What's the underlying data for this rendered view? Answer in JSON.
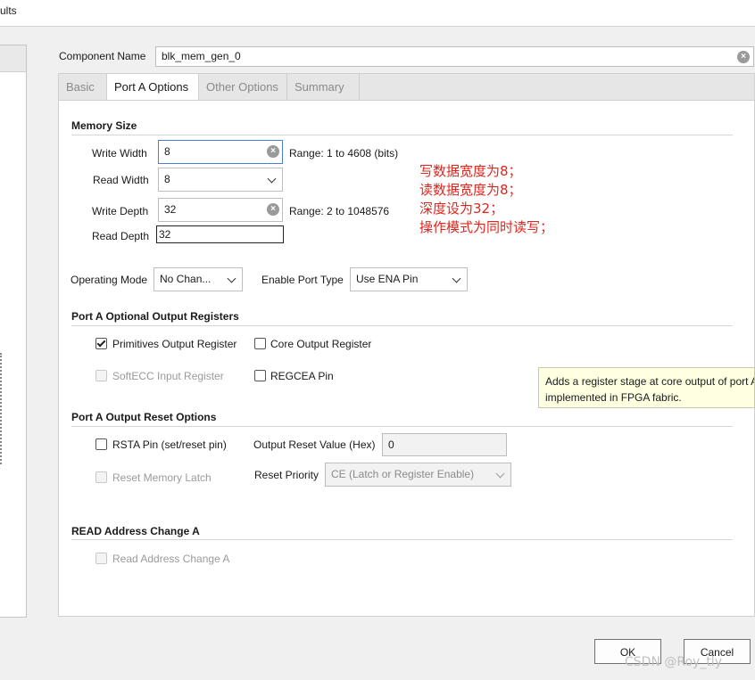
{
  "window": {
    "title_fragment": "ults"
  },
  "component_name": {
    "label": "Component Name",
    "value": "blk_mem_gen_0"
  },
  "tabs": [
    {
      "label": "Basic",
      "active": false
    },
    {
      "label": "Port A Options",
      "active": true
    },
    {
      "label": "Other Options",
      "active": false
    },
    {
      "label": "Summary",
      "active": false
    }
  ],
  "memory_size": {
    "heading": "Memory Size",
    "write_width": {
      "label": "Write Width",
      "value": "8",
      "range": "Range: 1 to 4608 (bits)"
    },
    "read_width": {
      "label": "Read Width",
      "value": "8"
    },
    "write_depth": {
      "label": "Write Depth",
      "value": "32",
      "range": "Range: 2 to 1048576"
    },
    "read_depth": {
      "label": "Read Depth",
      "value": "32"
    }
  },
  "annotation": [
    "写数据宽度为8；",
    "读数据宽度为8；",
    "深度设为32；",
    "操作模式为同时读写；"
  ],
  "operating_mode": {
    "label": "Operating Mode",
    "value": "No Chan..."
  },
  "enable_port_type": {
    "label": "Enable Port Type",
    "value": "Use ENA Pin"
  },
  "optional_output_registers": {
    "heading": "Port A Optional Output Registers",
    "primitives": {
      "label": "Primitives Output Register",
      "checked": true
    },
    "core": {
      "label": "Core Output Register",
      "checked": false
    },
    "softecc": {
      "label": "SoftECC Input Register",
      "checked": false
    },
    "regcea": {
      "label": "REGCEA Pin",
      "checked": false
    }
  },
  "tooltip": {
    "line1": "Adds a register stage at core output of port A",
    "line2": "implemented in FPGA fabric."
  },
  "output_reset": {
    "heading": "Port A Output Reset Options",
    "rsta": {
      "label": "RSTA Pin (set/reset pin)",
      "checked": false
    },
    "reset_value": {
      "label": "Output Reset Value (Hex)",
      "value": "0"
    },
    "reset_memory_latch": {
      "label": "Reset Memory Latch",
      "checked": false
    },
    "reset_priority": {
      "label": "Reset Priority",
      "value": "CE (Latch or Register Enable)"
    }
  },
  "read_address": {
    "heading": "READ Address Change A",
    "checkbox": {
      "label": "Read Address Change A",
      "checked": false
    }
  },
  "buttons": {
    "ok": "OK",
    "cancel": "Cancel"
  },
  "watermark": "CSDN @Roy_tly",
  "colors": {
    "annotation": "#e0261d",
    "focus_border": "#4a7fd3",
    "tooltip_bg": "#ffffe1"
  }
}
